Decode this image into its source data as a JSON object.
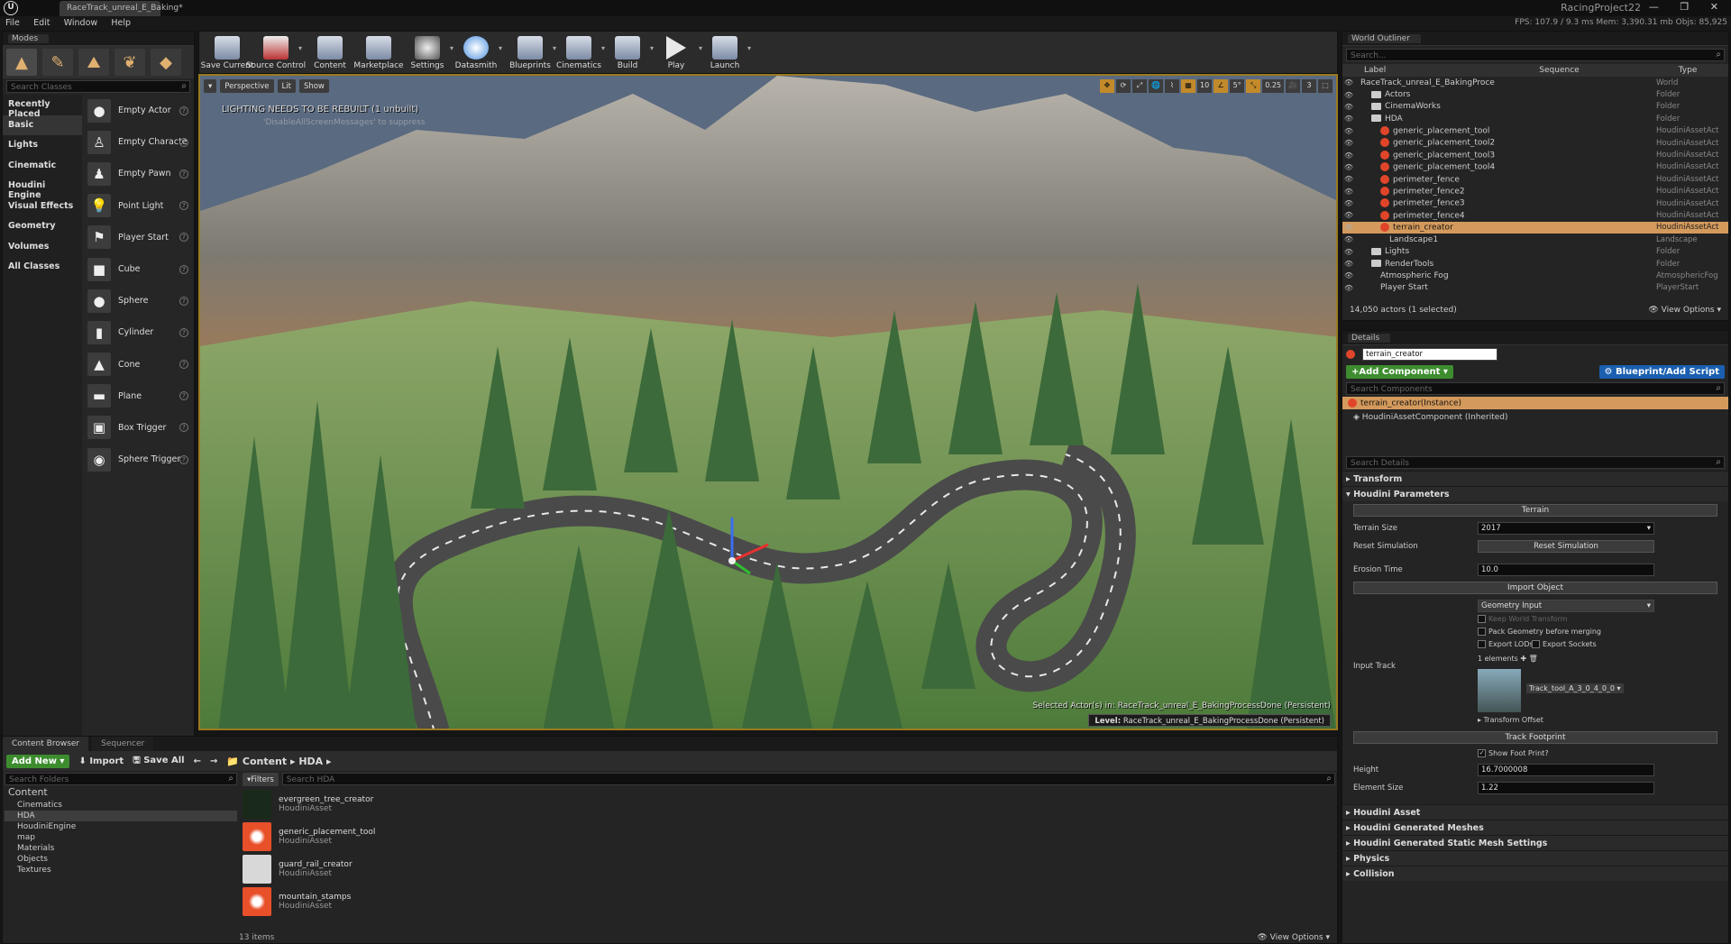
{
  "window": {
    "doc_tab": "RaceTrack_unreal_E_Baking*",
    "project": "RacingProject22",
    "stats": "FPS: 107.9 / 9.3 ms  Mem: 3,390.31 mb  Objs: 85,925",
    "controls": "— ❐ ✕"
  },
  "menu": [
    "File",
    "Edit",
    "Window",
    "Help"
  ],
  "modes": {
    "tab": "Modes",
    "search_placeholder": "Search Classes",
    "categories": [
      "Recently Placed",
      "Basic",
      "Lights",
      "Cinematic",
      "Houdini Engine",
      "Visual Effects",
      "Geometry",
      "Volumes",
      "All Classes"
    ],
    "items": [
      "Empty Actor",
      "Empty Characte",
      "Empty Pawn",
      "Point Light",
      "Player Start",
      "Cube",
      "Sphere",
      "Cylinder",
      "Cone",
      "Plane",
      "Box Trigger",
      "Sphere Trigger"
    ]
  },
  "toolbar": [
    "Save Current",
    "Source Control",
    "Content",
    "Marketplace",
    "Settings",
    "Datasmith",
    "Blueprints",
    "Cinematics",
    "Build",
    "Play",
    "Launch"
  ],
  "viewport": {
    "perspective": "Perspective",
    "lit": "Lit",
    "show": "Show",
    "grid": "10",
    "angle": "5°",
    "scale": "0.25",
    "cam": "3",
    "warning": "LIGHTING NEEDS TO BE REBUILT (1 unbuilt)",
    "warning2": "'DisableAllScreenMessages' to suppress",
    "selected": "Selected Actor(s) in:  RaceTrack_unreal_E_BakingProcessDone (Persistent)",
    "level_label": "Level:",
    "level": "RaceTrack_unreal_E_BakingProcessDone (Persistent)"
  },
  "content_browser": {
    "tab": "Content Browser",
    "tab2": "Sequencer",
    "add_new": "Add New",
    "import": "Import",
    "save_all": "Save All",
    "crumb1": "Content",
    "crumb2": "HDA",
    "folder_search": "Search Folders",
    "filters": "Filters",
    "asset_search": "Search HDA",
    "tree": [
      "Content",
      "Cinematics",
      "HDA",
      "HoudiniEngine",
      "map",
      "Materials",
      "Objects",
      "Textures"
    ],
    "assets": [
      {
        "name": "evergreen_tree_creator",
        "type": "HoudiniAsset"
      },
      {
        "name": "generic_placement_tool",
        "type": "HoudiniAsset"
      },
      {
        "name": "guard_rail_creator",
        "type": "HoudiniAsset"
      },
      {
        "name": "mountain_stamps",
        "type": "HoudiniAsset"
      }
    ],
    "count": "13 items",
    "view_options": "View Options"
  },
  "outliner": {
    "tab": "World Outliner",
    "search": "Search...",
    "col_label": "Label",
    "col_seq": "Sequence",
    "col_type": "Type",
    "rows": [
      {
        "label": "RaceTrack_unreal_E_BakingProce",
        "type": "World"
      },
      {
        "label": "Actors",
        "type": "Folder"
      },
      {
        "label": "CinemaWorks",
        "type": "Folder"
      },
      {
        "label": "HDA",
        "type": "Folder"
      },
      {
        "label": "generic_placement_tool",
        "type": "HoudiniAssetAct"
      },
      {
        "label": "generic_placement_tool2",
        "type": "HoudiniAssetAct"
      },
      {
        "label": "generic_placement_tool3",
        "type": "HoudiniAssetAct"
      },
      {
        "label": "generic_placement_tool4",
        "type": "HoudiniAssetAct"
      },
      {
        "label": "perimeter_fence",
        "type": "HoudiniAssetAct"
      },
      {
        "label": "perimeter_fence2",
        "type": "HoudiniAssetAct"
      },
      {
        "label": "perimeter_fence3",
        "type": "HoudiniAssetAct"
      },
      {
        "label": "perimeter_fence4",
        "type": "HoudiniAssetAct"
      },
      {
        "label": "terrain_creator",
        "type": "HoudiniAssetAct"
      },
      {
        "label": "Landscape1",
        "type": "Landscape"
      },
      {
        "label": "Lights",
        "type": "Folder"
      },
      {
        "label": "RenderTools",
        "type": "Folder"
      },
      {
        "label": "Atmospheric Fog",
        "type": "AtmosphericFog"
      },
      {
        "label": "Player Start",
        "type": "PlayerStart"
      }
    ],
    "count": "14,050 actors (1 selected)",
    "view_options": "View Options"
  },
  "details": {
    "tab": "Details",
    "name": "terrain_creator",
    "add_component": "+Add Component",
    "blueprint": "Blueprint/Add Script",
    "search_components": "Search Components",
    "instance": "terrain_creator(Instance)",
    "component": "HoudiniAssetComponent (Inherited)",
    "search_details": "Search Details",
    "transform": "Transform",
    "houdini_params": "Houdini Parameters",
    "terrain_btn": "Terrain",
    "terrain_size_label": "Terrain Size",
    "terrain_size": "2017",
    "reset_sim_label": "Reset Simulation",
    "reset_sim_btn": "Reset Simulation",
    "erosion_label": "Erosion Time",
    "erosion": "10.0",
    "import_object": "Import Object",
    "geometry_input": "Geometry Input",
    "keep_world": "Keep World Transform",
    "pack_geo": "Pack Geometry before merging",
    "export_lods": "Export LODs",
    "export_sockets": "Export Sockets",
    "input_track_label": "Input Track",
    "elements": "1 elements",
    "track_asset": "Track_tool_A_3_0_4_0_0",
    "transform_offset": "Transform Offset",
    "track_footprint": "Track Footprint",
    "show_footprint": "Show Foot Print?",
    "height_label": "Height",
    "height": "16.7000008",
    "element_size_label": "Element Size",
    "element_size": "1.22",
    "sections": [
      "Houdini Asset",
      "Houdini Generated Meshes",
      "Houdini Generated Static Mesh Settings",
      "Physics",
      "Collision"
    ]
  }
}
